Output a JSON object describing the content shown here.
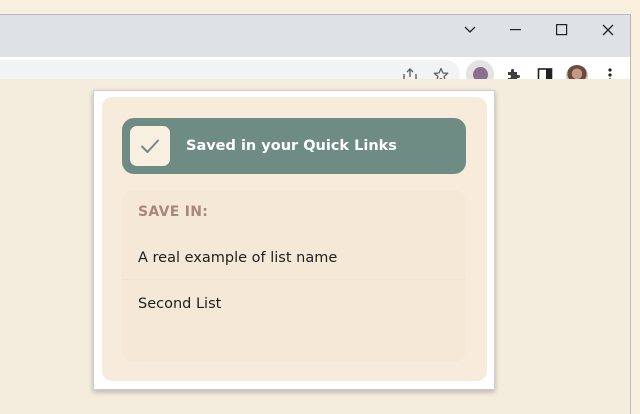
{
  "browser": {
    "icons": [
      "tab-search-icon",
      "minimize-icon",
      "maximize-icon",
      "close-icon",
      "share-icon",
      "star-icon",
      "extension-icon",
      "puzzle-icon",
      "side-panel-icon",
      "kebab-menu-icon"
    ],
    "accent_color": "#8b6f8e"
  },
  "popup": {
    "banner": {
      "text": "Saved in your Quick Links",
      "color": "#6e8b84"
    },
    "save_in": {
      "label": "SAVE IN:",
      "lists": [
        {
          "name": "A real example of list name"
        },
        {
          "name": "Second List"
        }
      ]
    }
  }
}
